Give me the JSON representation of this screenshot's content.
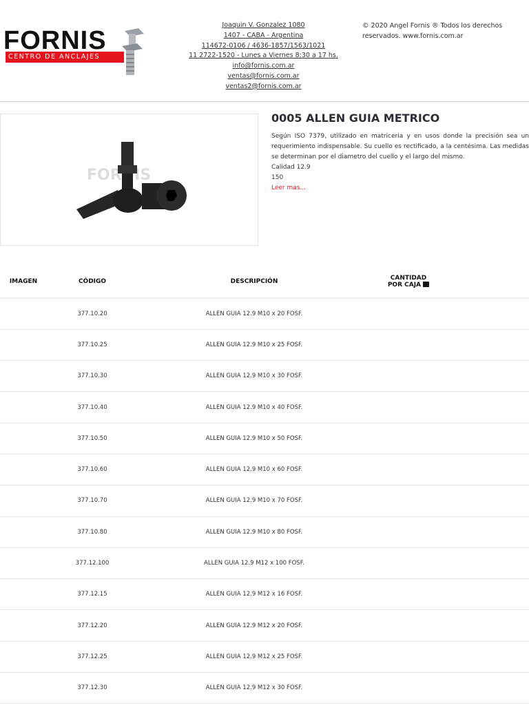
{
  "logo": {
    "name": "FORNIS",
    "tagline": "CENTRO DE ANCLAJES"
  },
  "contact": [
    "Joaquin V. Gonzalez 1080",
    "1407 - CABA - Argentina",
    "114672-0106 / 4636-1857/1563/1021",
    "11 2722-1520 - Lunes a Viernes 8:30 a 17 hs.",
    "info@fornis.com.ar",
    "ventas@fornis.com.ar",
    "ventas2@fornis.com.ar"
  ],
  "copyright": "© 2020 Angel Fornis ® Todos los derechos reservados. www.fornis.com.ar",
  "product": {
    "title": "0005 ALLEN GUIA METRICO",
    "description": "Según ISO 7379, utilizado en matriceria y en usos donde la precisión sea un requerimiento indispensable. Su cuello es rectificado, a la centésima. Las medidas se determinan por el diametro del cuello y el largo del mismo.",
    "quality": "Calidad 12.9",
    "number": "150",
    "read_more": "Leer mas..."
  },
  "table": {
    "headers": [
      "IMAGEN",
      "CÓDIGO",
      "DESCRIPCIÓN",
      "CANTIDAD",
      "POR CAJA"
    ],
    "rows": [
      {
        "code": "377.10.20",
        "desc": "ALLEN GUIA 12.9 M10 x 20 FOSF."
      },
      {
        "code": "377.10.25",
        "desc": "ALLEN GUIA 12.9 M10 x 25 FOSF."
      },
      {
        "code": "377.10.30",
        "desc": "ALLEN GUIA 12.9 M10 x 30 FOSF."
      },
      {
        "code": "377.10.40",
        "desc": "ALLEN GUIA 12.9 M10 x 40 FOSF."
      },
      {
        "code": "377.10.50",
        "desc": "ALLEN GUIA 12.9 M10 x 50 FOSF."
      },
      {
        "code": "377.10.60",
        "desc": "ALLEN GUIA 12.9 M10 x 60 FOSF."
      },
      {
        "code": "377.10.70",
        "desc": "ALLEN GUIA 12.9 M10 x 70 FOSF."
      },
      {
        "code": "377.10.80",
        "desc": "ALLEN GUIA 12.9 M10 x 80 FOSF."
      },
      {
        "code": "377.12.100",
        "desc": "ALLEN GUIA 12.9 M12 x 100 FOSF."
      },
      {
        "code": "377.12.15",
        "desc": "ALLEN GUIA 12.9 M12 x 16 FOSF."
      },
      {
        "code": "377.12.20",
        "desc": "ALLEN GUIA 12.9 M12 x 20 FOSF."
      },
      {
        "code": "377.12.25",
        "desc": "ALLEN GUIA 12.9 M12 x 25 FOSF."
      },
      {
        "code": "377.12.30",
        "desc": "ALLEN GUIA 12.9 M12 x 30 FOSF."
      }
    ]
  }
}
